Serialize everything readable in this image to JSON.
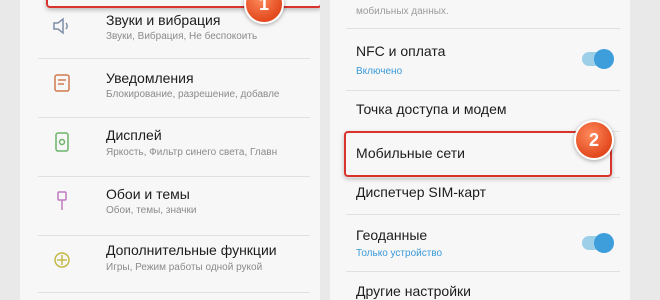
{
  "left_panel": {
    "items": [
      {
        "title": "Звуки и вибрация",
        "subtitle": "Звуки, Вибрация, Не беспокоить",
        "icon": "speaker-icon"
      },
      {
        "title": "Уведомления",
        "subtitle": "Блокирование, разрешение, добавле",
        "icon": "notification-icon"
      },
      {
        "title": "Дисплей",
        "subtitle": "Яркость, Фильтр синего света, Главн",
        "icon": "display-icon"
      },
      {
        "title": "Обои и темы",
        "subtitle": "Обои, темы, значки",
        "icon": "brush-icon"
      },
      {
        "title": "Дополнительные функции",
        "subtitle": "Игры, Режим работы одной рукой",
        "icon": "advanced-features-icon"
      }
    ],
    "badge": "1"
  },
  "right_panel": {
    "top_partial": "мобильных данных.",
    "items": [
      {
        "title": "NFC и оплата",
        "subtitle": "Включено",
        "toggle": true
      },
      {
        "title": "Точка доступа и модем"
      },
      {
        "title": "Мобильные сети"
      },
      {
        "title": "Диспетчер SIM-карт"
      },
      {
        "title": "Геоданные",
        "subtitle": "Только устройство",
        "toggle": true
      },
      {
        "title": "Другие настройки"
      }
    ],
    "badge": "2"
  },
  "colors": {
    "accent": "#3d9edb",
    "highlight": "#d9342b",
    "badge": "#e24a1e"
  }
}
